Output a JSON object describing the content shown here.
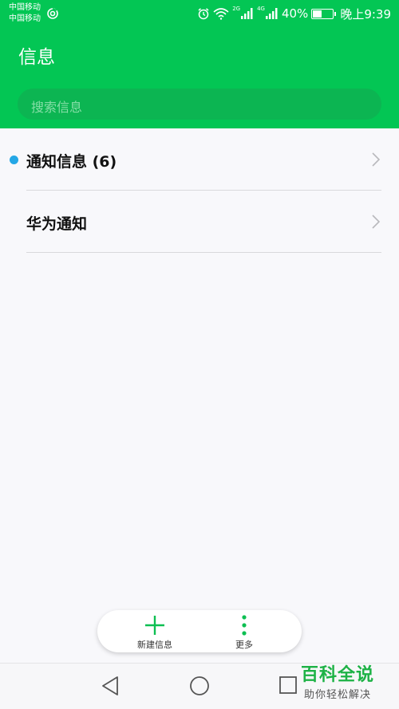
{
  "status_bar": {
    "carrier_1": "中国移动",
    "carrier_2": "中国移动",
    "network_tag_1": "2G",
    "network_tag_2": "4G",
    "battery_text": "40%",
    "battery_level": 0.4,
    "time": "晚上9:39"
  },
  "header": {
    "title": "信息",
    "search_placeholder": "搜索信息",
    "accent_color": "#03c654"
  },
  "list": {
    "items": [
      {
        "label": "通知信息 (6)",
        "unread_dot": true,
        "dot_color": "#24a7e6"
      },
      {
        "label": "华为通知",
        "unread_dot": false
      }
    ]
  },
  "bottom_actions": {
    "new_label": "新建信息",
    "more_label": "更多"
  },
  "nav": {
    "back_icon": "triangle-back-icon",
    "home_icon": "circle-home-icon",
    "recent_icon": "square-recent-icon"
  },
  "watermark": {
    "logo": "百科全说",
    "tagline": "助你轻松解决"
  }
}
